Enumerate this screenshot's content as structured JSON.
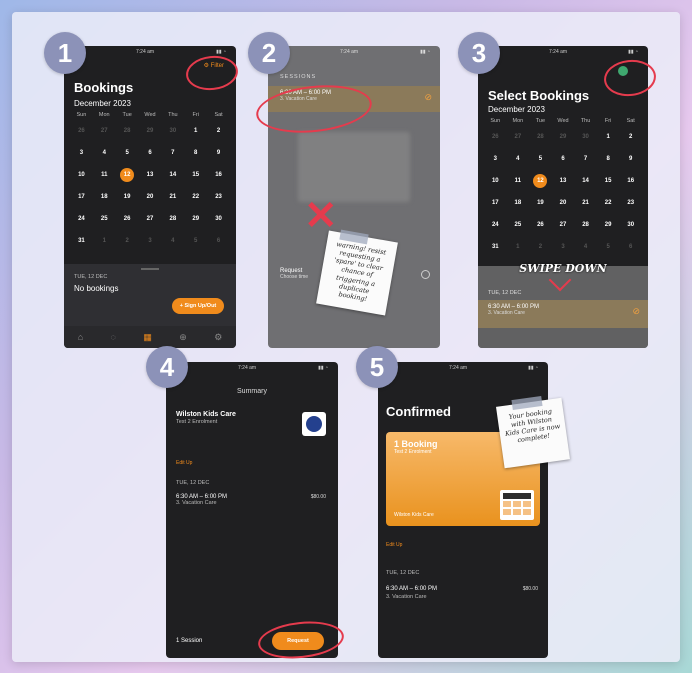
{
  "steps": [
    "1",
    "2",
    "3",
    "4",
    "5"
  ],
  "screen1": {
    "time": "7:24 am",
    "filter": "Filter",
    "title": "Bookings",
    "month": "December 2023",
    "weekdays": [
      "Sun",
      "Mon",
      "Tue",
      "Wed",
      "Thu",
      "Fri",
      "Sat"
    ],
    "weeks": [
      [
        "26",
        "27",
        "28",
        "29",
        "30",
        "1",
        "2"
      ],
      [
        "3",
        "4",
        "5",
        "6",
        "7",
        "8",
        "9"
      ],
      [
        "10",
        "11",
        "12",
        "13",
        "14",
        "15",
        "16"
      ],
      [
        "17",
        "18",
        "19",
        "20",
        "21",
        "22",
        "23"
      ],
      [
        "24",
        "25",
        "26",
        "27",
        "28",
        "29",
        "30"
      ],
      [
        "31",
        "1",
        "2",
        "3",
        "4",
        "5",
        "6"
      ]
    ],
    "selected": "12",
    "day_label": "TUE, 12 DEC",
    "empty": "No bookings",
    "signup": "Sign Up/Out"
  },
  "screen2": {
    "time": "7:24 am",
    "section": "SESSIONS",
    "slot_time": "6:30 AM – 6:00 PM",
    "slot_sub": "3. Vacation Care",
    "blurred_label": "Request",
    "blurred_sub": "Choose time",
    "note": "warning! resist requesting a 'spare' to clear chance of triggering a duplicate booking!"
  },
  "screen3": {
    "time": "7:24 am",
    "title": "Select Bookings",
    "month": "December 2023",
    "overlay": "SWIPE DOWN",
    "day_label": "TUE, 12 DEC",
    "slot_time": "6:30 AM – 6:00 PM",
    "slot_sub": "3. Vacation Care"
  },
  "screen4": {
    "time": "7:24 am",
    "title": "Summary",
    "provider": "Wilston Kids Care",
    "provider_sub": "Test 2 Enrolment",
    "link": "Edit Up",
    "day_label": "TUE, 12 DEC",
    "slot_time": "6:30 AM – 6:00 PM",
    "slot_sub": "3. Vacation Care",
    "price": "$80.00",
    "count": "1 Session",
    "request": "Request"
  },
  "screen5": {
    "time": "7:24 am",
    "title": "Confirmed",
    "card_title": "1 Booking",
    "card_sub": "Test 2 Enrolment",
    "provider": "Wilston Kids Care",
    "link": "Edit Up",
    "day_label": "TUE, 12 DEC",
    "slot_time": "6:30 AM – 6:00 PM",
    "slot_sub": "3. Vacation Care",
    "price": "$80.00",
    "note": "Your booking with Wilston Kids Care is now complete!"
  },
  "colors": {
    "accent": "#f08b1c",
    "marker": "#e53b4d",
    "phone": "#1f1f21",
    "step_badge": "#8c92b8"
  }
}
